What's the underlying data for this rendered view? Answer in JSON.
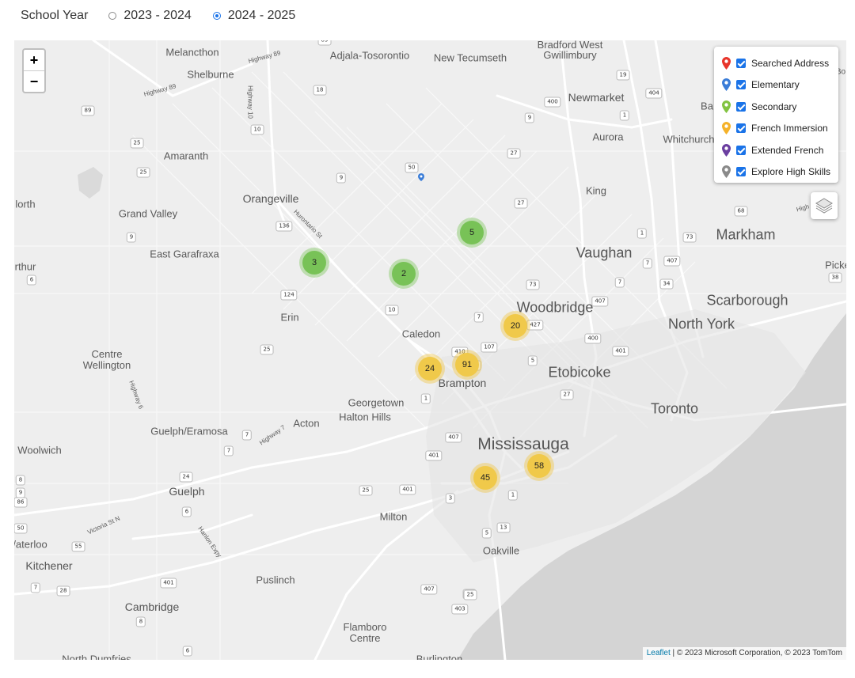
{
  "school_year": {
    "label": "School Year",
    "options": [
      {
        "label": "2023 - 2024",
        "selected": false
      },
      {
        "label": "2024 - 2025",
        "selected": true
      }
    ]
  },
  "map": {
    "zoom_in": "+",
    "zoom_out": "−",
    "cities": {
      "melancthon": "Melancthon",
      "shelburne": "Shelburne",
      "adjala": "Adjala-Tosorontio",
      "new_tecumseth": "New Tecumseth",
      "bradford": "Bradford West\nGwillimbury",
      "newmarket": "Newmarket",
      "aurora": "Aurora",
      "whitchurch": "Whitchurch",
      "ba": "Ba",
      "amaranth": "Amaranth",
      "king": "King",
      "orangeville": "Orangeville",
      "north": "lorth",
      "grand_valley": "Grand Valley",
      "markham": "Markham",
      "east_garafraxa": "East Garafraxa",
      "vaughan": "Vaughan",
      "arthur": "rthur",
      "picke": "Picke",
      "scarborough": "Scarborough",
      "woodbridge": "Woodbridge",
      "north_york": "North York",
      "erin": "Erin",
      "caledon": "Caledon",
      "centre_wellington": "Centre\nWellington",
      "etobicoke": "Etobicoke",
      "brampton": "Brampton",
      "georgetown": "Georgetown",
      "halton_hills": "Halton Hills",
      "toronto": "Toronto",
      "guelph_eramosa": "Guelph/Eramosa",
      "acton": "Acton",
      "mississauga": "Mississauga",
      "woolwich": "Woolwich",
      "guelph": "Guelph",
      "milton": "Milton",
      "waterloo": "/aterloo",
      "kitchener": "Kitchener",
      "oakville": "Oakville",
      "puslinch": "Puslinch",
      "cambridge": "Cambridge",
      "flamboro": "Flamboro\nCentre",
      "north_dumfries": "North Dumfries",
      "burlington": "Burlington",
      "bo": "Bo"
    },
    "road_names": {
      "highway89a": "Highway 89",
      "highway89b": "Highway 89",
      "highway10": "Highway 10",
      "hurontario": "Hurontario St",
      "highway6": "Highway 6",
      "highway7": "Highway 7",
      "victoria": "Victoria St N",
      "hanlon": "Hanlon Expy",
      "high": "High"
    },
    "shields": [
      "89",
      "89",
      "18",
      "19",
      "404",
      "10",
      "1",
      "400",
      "9",
      "25",
      "27",
      "25",
      "9",
      "50",
      "27",
      "9",
      "68",
      "136",
      "1",
      "73",
      "7",
      "407",
      "6",
      "34",
      "38",
      "124",
      "73",
      "10",
      "7",
      "407",
      "7",
      "427",
      "400",
      "25",
      "410",
      "5",
      "401",
      "107",
      "6",
      "27",
      "1",
      "7",
      "7",
      "407",
      "401",
      "24",
      "25",
      "401",
      "3",
      "1",
      "6",
      "5",
      "13",
      "55",
      "25",
      "401",
      "7",
      "28",
      "407",
      "25",
      "403",
      "8",
      "6",
      "8",
      "9",
      "50",
      "86"
    ],
    "clusters": [
      {
        "count": "5",
        "kind": "secondary",
        "color": "green"
      },
      {
        "count": "3",
        "kind": "secondary",
        "color": "green"
      },
      {
        "count": "2",
        "kind": "secondary",
        "color": "green"
      },
      {
        "count": "20",
        "kind": "french-immersion",
        "color": "yellow"
      },
      {
        "count": "91",
        "kind": "french-immersion",
        "color": "yellow"
      },
      {
        "count": "24",
        "kind": "french-immersion",
        "color": "yellow"
      },
      {
        "count": "58",
        "kind": "french-immersion",
        "color": "yellow"
      },
      {
        "count": "45",
        "kind": "french-immersion",
        "color": "yellow"
      }
    ],
    "legend": [
      {
        "label": "Searched Address",
        "color": "#e8352b",
        "checked": true
      },
      {
        "label": "Elementary",
        "color": "#3b7dd8",
        "checked": true
      },
      {
        "label": "Secondary",
        "color": "#82c341",
        "checked": true
      },
      {
        "label": "French Immersion",
        "color": "#f5b22a",
        "checked": true
      },
      {
        "label": "Extended French",
        "color": "#6b3fa0",
        "checked": true
      },
      {
        "label": "Explore High Skills",
        "color": "#8a8a8a",
        "checked": true
      }
    ],
    "attribution": {
      "leaflet": "Leaflet",
      "sep": " | ",
      "text": "© 2023 Microsoft Corporation, © 2023 TomTom"
    },
    "colors": {
      "land": "#eeeeee",
      "water": "#d4d4d4",
      "road": "#ffffff"
    }
  }
}
